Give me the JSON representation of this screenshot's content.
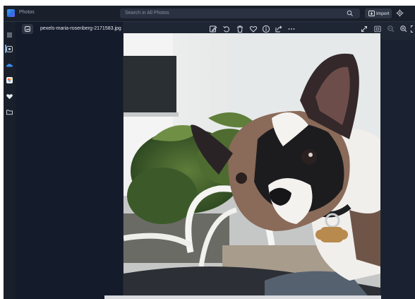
{
  "app": {
    "title": "Photos"
  },
  "search": {
    "placeholder": "Search in All Photos"
  },
  "header": {
    "import_label": "Import"
  },
  "viewer": {
    "file_name": "pexels-maria-rosenberg-2171583.jpg"
  },
  "icons": {
    "rail": [
      "hamburger-menu-icon",
      "gallery-icon",
      "onedrive-icon",
      "icloud-photos-icon",
      "favorites-heart-icon",
      "folders-icon"
    ],
    "toolbar": [
      "edit-icon",
      "rotate-icon",
      "delete-icon",
      "favorite-icon",
      "info-icon",
      "share-icon",
      "more-icon"
    ],
    "view": [
      "expand-icon",
      "fit-icon",
      "zoom-out-icon",
      "zoom-in-icon",
      "fullscreen-icon"
    ]
  },
  "colors": {
    "accent": "#5aa9ff",
    "panel": "#141b2b",
    "window": "#1f2633"
  }
}
